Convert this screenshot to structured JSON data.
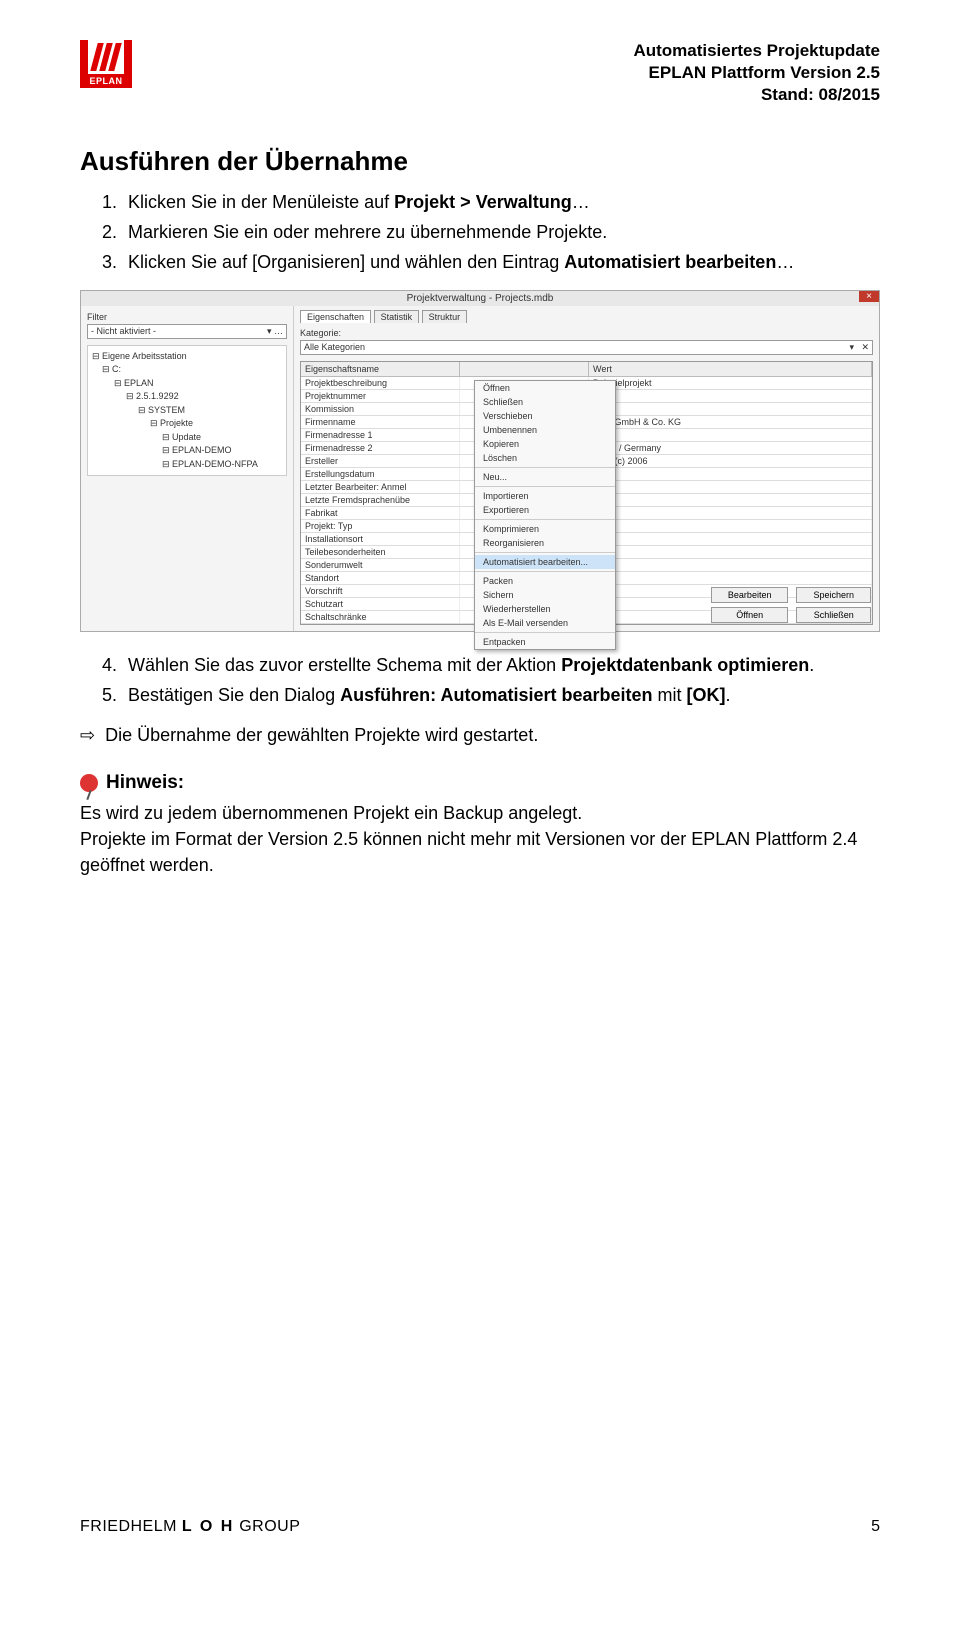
{
  "header": {
    "logo_label": "EPLAN",
    "line1": "Automatisiertes Projektupdate",
    "line2": "EPLAN Plattform Version 2.5",
    "line3": "Stand: 08/2015"
  },
  "section_title": "Ausführen der Übernahme",
  "steps_a": [
    {
      "pre": "Klicken Sie in der Menüleiste auf ",
      "b": "Projekt > Verwaltung",
      "post": "…"
    },
    {
      "pre": "Markieren Sie ein oder mehrere zu übernehmende Projekte.",
      "b": "",
      "post": ""
    },
    {
      "pre": "Klicken Sie auf [Organisieren] und wählen den Eintrag ",
      "b": "Automatisiert bearbeiten",
      "post": "…"
    }
  ],
  "steps_b_start": 4,
  "steps_b": [
    {
      "pre": "Wählen Sie das zuvor erstellte Schema mit der Aktion ",
      "b": "Projektdatenbank optimieren",
      "post": "."
    },
    {
      "pre": "Bestätigen Sie den Dialog ",
      "b": "Ausführen: Automatisiert bearbeiten",
      "post": " mit ",
      "b2": "[OK]",
      "post2": "."
    }
  ],
  "arrow_text": "Die Übernahme der gewählten Projekte wird gestartet.",
  "hint": {
    "label": "Hinweis:",
    "body": "Es wird zu jedem übernommenen Projekt ein Backup angelegt.\nProjekte im Format der Version 2.5 können nicht mehr mit Versionen vor der EPLAN Plattform 2.4 geöffnet werden."
  },
  "screenshot": {
    "title": "Projektverwaltung - Projects.mdb",
    "filter_label": "Filter",
    "filter_value": "- Nicht aktiviert -",
    "tree": [
      "Eigene Arbeitsstation",
      "C:",
      "EPLAN",
      "2.5.1.9292",
      "SYSTEM",
      "Projekte",
      "Update",
      "EPLAN-DEMO",
      "EPLAN-DEMO-NFPA"
    ],
    "tabs": [
      "Eigenschaften",
      "Statistik",
      "Struktur"
    ],
    "kat_label": "Kategorie:",
    "kat_value": "Alle Kategorien",
    "grid_headers": [
      "Eigenschaftsname",
      "",
      "Wert"
    ],
    "grid_rows": [
      [
        "Projektbeschreibung",
        "",
        "Beispielprojekt"
      ],
      [
        "Projektnummer",
        "",
        ""
      ],
      [
        "Kommission",
        "",
        ""
      ],
      [
        "Firmenname",
        "",
        "rvice GmbH & Co. KG"
      ],
      [
        "Firmenadresse 1",
        "",
        ""
      ],
      [
        "Firmenadresse 2",
        "",
        "Rhein / Germany"
      ],
      [
        "Ersteller",
        "",
        "rvice (c) 2006"
      ],
      [
        "Erstellungsdatum",
        "",
        ""
      ],
      [
        "Letzter Bearbeiter: Anmel",
        "",
        ""
      ],
      [
        "Letzte Fremdsprachenübe",
        "",
        ""
      ],
      [
        "Fabrikat",
        "",
        ""
      ],
      [
        "Projekt: Typ",
        "",
        ""
      ],
      [
        "Installationsort",
        "",
        ""
      ],
      [
        "Teilebesonderheiten",
        "",
        ""
      ],
      [
        "Sonderumwelt",
        "",
        ""
      ],
      [
        "Standort",
        "",
        ""
      ],
      [
        "Vorschrift",
        "",
        ""
      ],
      [
        "Schutzart",
        "",
        ""
      ],
      [
        "Schaltschränke",
        "",
        ""
      ]
    ],
    "context": [
      "Öffnen",
      "Schließen",
      "Verschieben",
      "Umbenennen",
      "Kopieren",
      "Löschen",
      "—",
      "Neu...",
      "—",
      "Importieren",
      "Exportieren",
      "—",
      "Komprimieren",
      "Reorganisieren",
      "—",
      "Automatisiert bearbeiten...",
      "—",
      "Packen",
      "Sichern",
      "Wiederherstellen",
      "Als E-Mail versenden",
      "—",
      "Entpacken"
    ],
    "buttons": [
      "Bearbeiten",
      "Speichern",
      "Öffnen",
      "Schließen"
    ]
  },
  "footer": {
    "brand_pre": "FRIEDHELM ",
    "brand_b": "L O H",
    "brand_post": " GROUP",
    "page": "5"
  }
}
